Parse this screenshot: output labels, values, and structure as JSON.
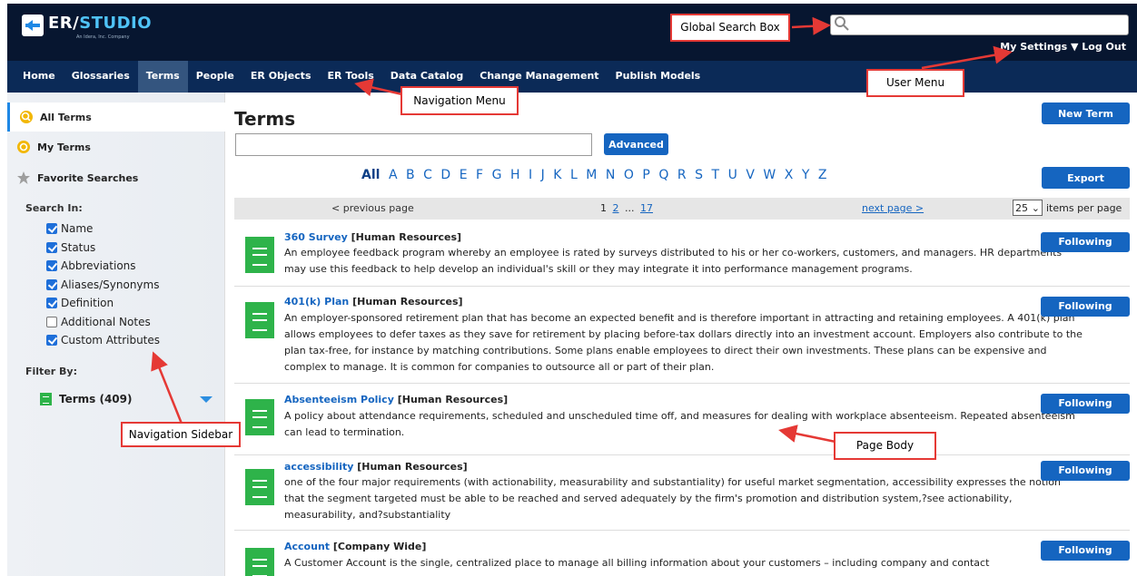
{
  "header": {
    "logo_main": "ER/",
    "logo_accent": "STUDIO",
    "logo_sub": "An Idera, Inc. Company",
    "search_placeholder": "",
    "my_settings": "My Settings ▼",
    "log_out": "Log Out"
  },
  "nav": {
    "items": [
      "Home",
      "Glossaries",
      "Terms",
      "People",
      "ER Objects",
      "ER Tools",
      "Data Catalog",
      "Change Management",
      "Publish Models"
    ],
    "active": "Terms"
  },
  "sidebar": {
    "all_terms": "All Terms",
    "my_terms": "My Terms",
    "favorite_searches": "Favorite Searches",
    "search_in_label": "Search In:",
    "search_in": [
      {
        "label": "Name",
        "checked": true
      },
      {
        "label": "Status",
        "checked": true
      },
      {
        "label": "Abbreviations",
        "checked": true
      },
      {
        "label": "Aliases/Synonyms",
        "checked": true
      },
      {
        "label": "Definition",
        "checked": true
      },
      {
        "label": "Additional Notes",
        "checked": false
      },
      {
        "label": "Custom Attributes",
        "checked": true
      }
    ],
    "filter_by_label": "Filter By:",
    "filter_terms": "Terms (409)"
  },
  "main": {
    "title": "Terms",
    "advanced_button": "Advanced",
    "new_term_button": "New Term",
    "export_button": "Export",
    "alphabet": [
      "All",
      "A",
      "B",
      "C",
      "D",
      "E",
      "F",
      "G",
      "H",
      "I",
      "J",
      "K",
      "L",
      "M",
      "N",
      "O",
      "P",
      "Q",
      "R",
      "S",
      "T",
      "U",
      "V",
      "W",
      "X",
      "Y",
      "Z"
    ],
    "alphabet_selected": "All",
    "pager": {
      "previous": "< previous page",
      "current_page": "1",
      "page_2": "2",
      "ellipsis": "...",
      "last_page": "17",
      "next": "next page >",
      "per_page_value": "25",
      "per_page_label": "items per page"
    },
    "following_label": "Following",
    "terms": [
      {
        "name": "360 Survey",
        "category": " [Human Resources]",
        "description": "An employee feedback program whereby an employee is rated by surveys distributed to his or her co-workers, customers, and managers. HR departments may use this feedback to help develop an individual's skill or they may integrate it into performance management programs."
      },
      {
        "name": "401(k) Plan",
        "category": " [Human Resources]",
        "description": "An employer-sponsored retirement plan that has become an expected benefit and is therefore important in attracting and retaining employees. A 401(k) plan allows employees to defer taxes as they save for retirement by placing before-tax dollars directly into an investment account. Employers also contribute to the plan tax-free, for instance by matching contributions. Some plans enable employees to direct their own investments. These plans can be expensive and complex to manage. It is common for companies to outsource all or part of their plan."
      },
      {
        "name": "Absenteeism Policy",
        "category": " [Human Resources]",
        "description": "A policy about attendance requirements, scheduled and unscheduled time off, and measures for dealing with workplace absenteeism. Repeated absenteeism can lead to termination."
      },
      {
        "name": "accessibility",
        "category": " [Human Resources]",
        "description": "one of the four major requirements (with actionability, measurability and substantiality) for useful market segmentation, accessibility expresses the notion that the segment targeted must be able to be reached and served adequately by the firm's promotion and distribution system,?see actionability, measurability, and?substantiality"
      },
      {
        "name": "Account",
        "category": " [Company Wide]",
        "description": "A Customer Account is the single, centralized place to manage all billing information about your customers – including company and contact"
      }
    ]
  },
  "callouts": {
    "global_search": "Global Search Box",
    "user_menu": "User Menu",
    "navigation_menu": "Navigation Menu",
    "navigation_sidebar": "Navigation Sidebar",
    "page_body": "Page Body"
  },
  "colors": {
    "header_bg": "#071630",
    "nav_bg": "#0b2a57",
    "primary": "#1565c0",
    "term_icon": "#2eb34a",
    "callout_border": "#e53935"
  }
}
